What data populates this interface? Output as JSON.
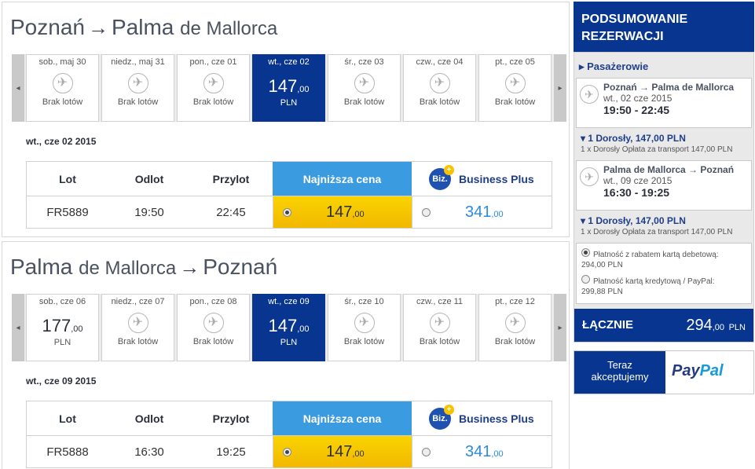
{
  "legs": [
    {
      "route_from": "Poznań",
      "route_to_main": "Palma",
      "route_to_sub": "de Mallorca",
      "days": [
        {
          "label": "sob., maj 30",
          "status": "Brak lotów"
        },
        {
          "label": "niedz., maj 31",
          "status": "Brak lotów"
        },
        {
          "label": "pon., cze 01",
          "status": "Brak lotów"
        },
        {
          "label": "wt., cze 02",
          "price": "147",
          "cents": ",00",
          "currency": "PLN"
        },
        {
          "label": "śr., cze 03",
          "status": "Brak lotów"
        },
        {
          "label": "czw., cze 04",
          "status": "Brak lotów"
        },
        {
          "label": "pt., cze 05",
          "status": "Brak lotów"
        }
      ],
      "selected_date": "wt., cze 02 2015",
      "flight": {
        "number": "FR5889",
        "depart": "19:50",
        "arrive": "22:45",
        "lowest": "147",
        "lowest_cents": ",00",
        "business": "341",
        "business_cents": ",00"
      }
    },
    {
      "route_from_main": "Palma",
      "route_from_sub": "de Mallorca",
      "route_to": "Poznań",
      "days": [
        {
          "label": "sob., cze 06",
          "price": "177",
          "cents": ",00",
          "currency": "PLN"
        },
        {
          "label": "niedz., cze 07",
          "status": "Brak lotów"
        },
        {
          "label": "pon., cze 08",
          "status": "Brak lotów"
        },
        {
          "label": "wt., cze 09",
          "price": "147",
          "cents": ",00",
          "currency": "PLN"
        },
        {
          "label": "śr., cze 10",
          "status": "Brak lotów"
        },
        {
          "label": "czw., cze 11",
          "status": "Brak lotów"
        },
        {
          "label": "pt., cze 12",
          "status": "Brak lotów"
        }
      ],
      "selected_date": "wt., cze 09 2015",
      "flight": {
        "number": "FR5888",
        "depart": "16:30",
        "arrive": "19:25",
        "lowest": "147",
        "lowest_cents": ",00",
        "business": "341",
        "business_cents": ",00"
      }
    }
  ],
  "table_headers": {
    "lot": "Lot",
    "odlot": "Odlot",
    "przylot": "Przylot",
    "lowest": "Najniższa cena",
    "business": "Business Plus",
    "biz_badge": "Biz."
  },
  "nav": {
    "prev": "◂",
    "next": "▸"
  },
  "sidebar": {
    "title_line1": "PODSUMOWANIE",
    "title_line2": "REZERWACJI",
    "passengers": "▸ Pasażerowie",
    "out": {
      "route": "Poznań → Palma de Mallorca",
      "date": "wt., 02 cze 2015",
      "time": "19:50 - 22:45",
      "pax": "▾ 1 Dorosły, 147,00 PLN",
      "pax_detail": "1 x Dorosły Opłata za transport 147,00 PLN"
    },
    "ret": {
      "route": "Palma de Mallorca → Poznań",
      "date": "wt., 09 cze 2015",
      "time": "16:30 - 19:25",
      "pax": "▾ 1 Dorosły, 147,00 PLN",
      "pax_detail": "1 x Dorosły Opłata za transport 147,00 PLN"
    },
    "payment": {
      "opt1": "Płatność z rabatem kartą debetową:",
      "opt1_val": "294,00 PLN",
      "opt2": "Płatność kartą kredytową / PayPal:",
      "opt2_val": "299,88 PLN"
    },
    "total_label": "ŁĄCZNIE",
    "total_value": "294",
    "total_cents": ",00",
    "total_currency": "PLN",
    "paypal_text1": "Teraz",
    "paypal_text2": "akceptujemy",
    "paypal_logo_pay": "Pay",
    "paypal_logo_pal": "Pal"
  },
  "icons": {
    "plane": "plane-icon"
  }
}
